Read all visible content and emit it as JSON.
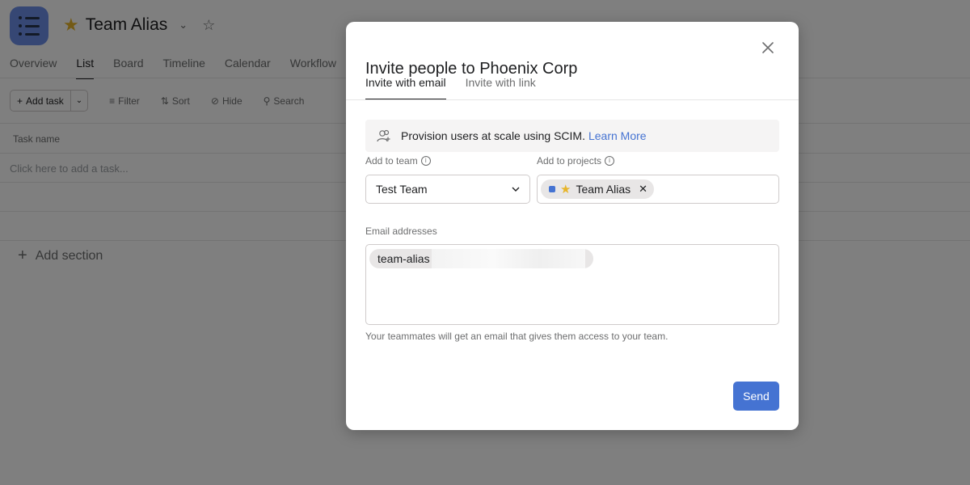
{
  "project": {
    "title": "Team Alias",
    "star_glyph": "★",
    "tabs": [
      {
        "label": "Overview"
      },
      {
        "label": "List"
      },
      {
        "label": "Board"
      },
      {
        "label": "Timeline"
      },
      {
        "label": "Calendar"
      },
      {
        "label": "Workflow"
      }
    ],
    "active_tab": "List"
  },
  "toolbar": {
    "add_task": "Add task",
    "filter": "Filter",
    "sort": "Sort",
    "hide": "Hide",
    "search": "Search"
  },
  "list": {
    "header_task_name": "Task name",
    "add_task_placeholder": "Click here to add a task...",
    "add_section": "Add section"
  },
  "modal": {
    "title": "Invite people to Phoenix Corp",
    "tabs": [
      {
        "label": "Invite with email"
      },
      {
        "label": "Invite with link"
      }
    ],
    "active_tab": "Invite with email",
    "scim": {
      "text": "Provision users at scale using SCIM.",
      "link": "Learn More"
    },
    "team": {
      "label": "Add to team",
      "value": "Test Team"
    },
    "projects": {
      "label": "Add to projects",
      "chips": [
        {
          "label": "Team Alias",
          "color": "#4573d2"
        }
      ]
    },
    "emails": {
      "label": "Email addresses",
      "chips": [
        {
          "label": "team-alias"
        }
      ]
    },
    "helper_text": "Your teammates will get an email that gives them access to your team.",
    "send_label": "Send"
  },
  "colors": {
    "accent": "#4573d2",
    "brand_icon": "#6d8ee8",
    "star": "#e7b52a"
  }
}
